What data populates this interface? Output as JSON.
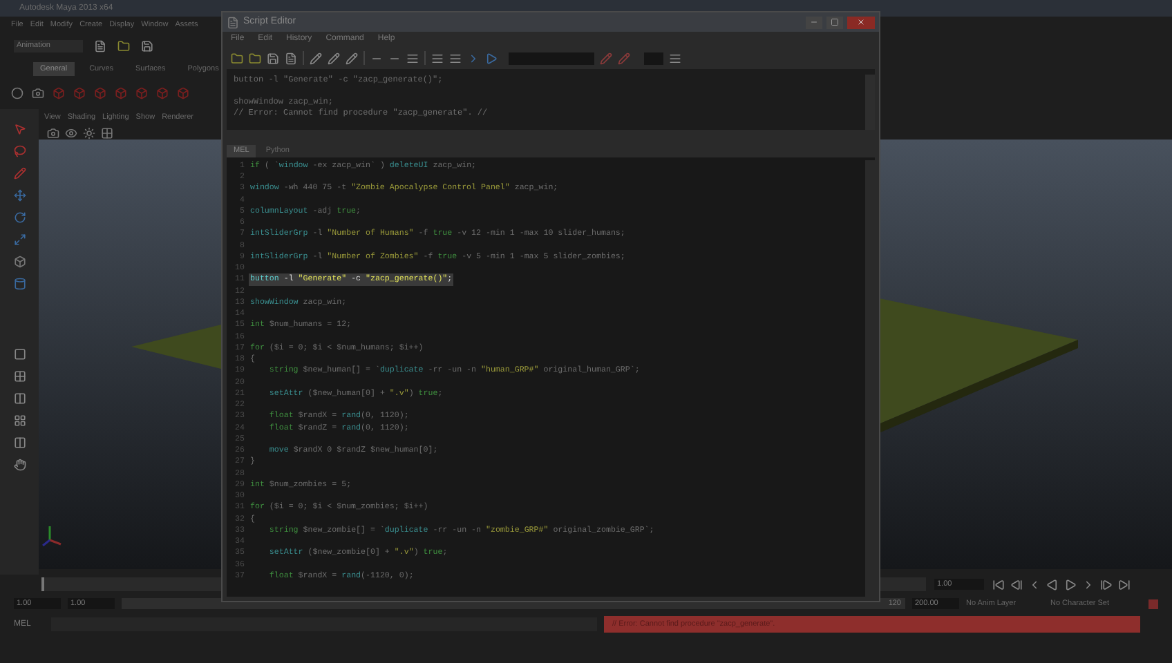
{
  "maya": {
    "title": "Autodesk Maya 2013 x64",
    "menus": [
      "File",
      "Edit",
      "Modify",
      "Create",
      "Display",
      "Window",
      "Assets"
    ],
    "mode": "Animation",
    "shelf_tabs": [
      {
        "label": "General",
        "selected": true
      },
      {
        "label": "Curves",
        "selected": false
      },
      {
        "label": "Surfaces",
        "selected": false
      },
      {
        "label": "Polygons",
        "selected": false
      }
    ],
    "panel_menus": [
      "View",
      "Shading",
      "Lighting",
      "Show",
      "Renderer"
    ],
    "time_slider": {
      "level": 0
    },
    "range_slider": {
      "level": 1
    },
    "current_frame": "1.00",
    "range_start": "1.00",
    "playback_start": "1.00",
    "range_end": "120",
    "playback_end": "200.00",
    "anim_layer": "No Anim Layer",
    "character_set": "No Character Set",
    "command_label": "MEL",
    "error": "// Error: Cannot find procedure \"zacp_generate\"."
  },
  "script_editor": {
    "title": "Script Editor",
    "menus": [
      "File",
      "Edit",
      "History",
      "Command",
      "Help"
    ],
    "history": [
      {
        "kind": "output",
        "text": "button -l \"Generate\" -c \"zacp_generate()\";"
      },
      {
        "kind": "blank"
      },
      {
        "kind": "output",
        "text": "showWindow zacp_win;"
      },
      {
        "kind": "error",
        "text": "// Error: Cannot find procedure \"zacp_generate\". //"
      }
    ],
    "tabs": [
      {
        "label": "MEL",
        "selected": true
      },
      {
        "label": "Python",
        "selected": false
      }
    ],
    "code": [
      {
        "n": "1",
        "highlighted": false,
        "tokens": [
          {
            "kind": "keyword",
            "text": "if"
          },
          {
            "kind": "plain",
            "text": " ( `"
          },
          {
            "kind": "command",
            "text": "window"
          },
          {
            "kind": "plain",
            "text": " -ex zacp_win` ) "
          },
          {
            "kind": "command",
            "text": "deleteUI"
          },
          {
            "kind": "plain",
            "text": " zacp_win;"
          }
        ]
      },
      {
        "n": "2",
        "highlighted": false
      },
      {
        "n": "3",
        "highlighted": false,
        "tokens": [
          {
            "kind": "command",
            "text": "window"
          },
          {
            "kind": "plain",
            "text": " -wh 440 75 -t "
          },
          {
            "kind": "string",
            "text": "\"Zombie Apocalypse Control Panel\""
          },
          {
            "kind": "plain",
            "text": " zacp_win;"
          }
        ]
      },
      {
        "n": "4",
        "highlighted": false
      },
      {
        "n": "5",
        "highlighted": false,
        "tokens": [
          {
            "kind": "command",
            "text": "columnLayout"
          },
          {
            "kind": "plain",
            "text": " -adj "
          },
          {
            "kind": "keyword",
            "text": "true"
          },
          {
            "kind": "plain",
            "text": ";"
          }
        ]
      },
      {
        "n": "6",
        "highlighted": false
      },
      {
        "n": "7",
        "highlighted": false,
        "tokens": [
          {
            "kind": "command",
            "text": "intSliderGrp"
          },
          {
            "kind": "plain",
            "text": " -l "
          },
          {
            "kind": "string",
            "text": "\"Number of Humans\""
          },
          {
            "kind": "plain",
            "text": " -f "
          },
          {
            "kind": "keyword",
            "text": "true"
          },
          {
            "kind": "plain",
            "text": " -v 12 -min 1 -max 10 slider_humans;"
          }
        ]
      },
      {
        "n": "8",
        "highlighted": false
      },
      {
        "n": "9",
        "highlighted": false,
        "tokens": [
          {
            "kind": "command",
            "text": "intSliderGrp"
          },
          {
            "kind": "plain",
            "text": " -l "
          },
          {
            "kind": "string",
            "text": "\"Number of Zombies\""
          },
          {
            "kind": "plain",
            "text": " -f "
          },
          {
            "kind": "keyword",
            "text": "true"
          },
          {
            "kind": "plain",
            "text": " -v 5 -min 1 -max 5 slider_zombies;"
          }
        ]
      },
      {
        "n": "10",
        "highlighted": false
      },
      {
        "n": "11",
        "highlighted": true,
        "tokens": [
          {
            "kind": "command",
            "text": "button"
          },
          {
            "kind": "plain",
            "text": " -l "
          },
          {
            "kind": "string",
            "text": "\"Generate\""
          },
          {
            "kind": "plain",
            "text": " -c "
          },
          {
            "kind": "string",
            "text": "\"zacp_generate()\""
          },
          {
            "kind": "plain",
            "text": ";"
          }
        ]
      },
      {
        "n": "12",
        "highlighted": false
      },
      {
        "n": "13",
        "highlighted": false,
        "tokens": [
          {
            "kind": "command",
            "text": "showWindow"
          },
          {
            "kind": "plain",
            "text": " zacp_win;"
          }
        ]
      },
      {
        "n": "14",
        "highlighted": false
      },
      {
        "n": "15",
        "highlighted": false,
        "tokens": [
          {
            "kind": "keyword",
            "text": "int"
          },
          {
            "kind": "plain",
            "text": " $num_humans = 12;"
          }
        ]
      },
      {
        "n": "16",
        "highlighted": false
      },
      {
        "n": "17",
        "highlighted": false,
        "tokens": [
          {
            "kind": "keyword",
            "text": "for"
          },
          {
            "kind": "plain",
            "text": " ($i = 0; $i < $num_humans; $i++)"
          }
        ]
      },
      {
        "n": "18",
        "highlighted": false,
        "tokens": [
          {
            "kind": "plain",
            "text": "{"
          }
        ]
      },
      {
        "n": "19",
        "highlighted": false,
        "tokens": [
          {
            "kind": "keyword",
            "text": "    string"
          },
          {
            "kind": "plain",
            "text": " $new_human[] = `"
          },
          {
            "kind": "command",
            "text": "duplicate"
          },
          {
            "kind": "plain",
            "text": " -rr -un -n "
          },
          {
            "kind": "string",
            "text": "\"human_GRP#\""
          },
          {
            "kind": "plain",
            "text": " original_human_GRP`;"
          }
        ]
      },
      {
        "n": "20",
        "highlighted": false
      },
      {
        "n": "21",
        "highlighted": false,
        "tokens": [
          {
            "kind": "command",
            "text": "    setAttr"
          },
          {
            "kind": "plain",
            "text": " ($new_human[0] + "
          },
          {
            "kind": "string",
            "text": "\".v\""
          },
          {
            "kind": "plain",
            "text": ") "
          },
          {
            "kind": "keyword",
            "text": "true"
          },
          {
            "kind": "plain",
            "text": ";"
          }
        ]
      },
      {
        "n": "22",
        "highlighted": false
      },
      {
        "n": "23",
        "highlighted": false,
        "tokens": [
          {
            "kind": "keyword",
            "text": "    float"
          },
          {
            "kind": "plain",
            "text": " $randX = "
          },
          {
            "kind": "command",
            "text": "rand"
          },
          {
            "kind": "plain",
            "text": "(0, 1120);"
          }
        ]
      },
      {
        "n": "24",
        "highlighted": false,
        "tokens": [
          {
            "kind": "keyword",
            "text": "    float"
          },
          {
            "kind": "plain",
            "text": " $randZ = "
          },
          {
            "kind": "command",
            "text": "rand"
          },
          {
            "kind": "plain",
            "text": "(0, 1120);"
          }
        ]
      },
      {
        "n": "25",
        "highlighted": false
      },
      {
        "n": "26",
        "highlighted": false,
        "tokens": [
          {
            "kind": "command",
            "text": "    move"
          },
          {
            "kind": "plain",
            "text": " $randX 0 $randZ $new_human[0];"
          }
        ]
      },
      {
        "n": "27",
        "highlighted": false,
        "tokens": [
          {
            "kind": "plain",
            "text": "}"
          }
        ]
      },
      {
        "n": "28",
        "highlighted": false
      },
      {
        "n": "29",
        "highlighted": false,
        "tokens": [
          {
            "kind": "keyword",
            "text": "int"
          },
          {
            "kind": "plain",
            "text": " $num_zombies = 5;"
          }
        ]
      },
      {
        "n": "30",
        "highlighted": false
      },
      {
        "n": "31",
        "highlighted": false,
        "tokens": [
          {
            "kind": "keyword",
            "text": "for"
          },
          {
            "kind": "plain",
            "text": " ($i = 0; $i < $num_zombies; $i++)"
          }
        ]
      },
      {
        "n": "32",
        "highlighted": false,
        "tokens": [
          {
            "kind": "plain",
            "text": "{"
          }
        ]
      },
      {
        "n": "33",
        "highlighted": false,
        "tokens": [
          {
            "kind": "keyword",
            "text": "    string"
          },
          {
            "kind": "plain",
            "text": " $new_zombie[] = `"
          },
          {
            "kind": "command",
            "text": "duplicate"
          },
          {
            "kind": "plain",
            "text": " -rr -un -n "
          },
          {
            "kind": "string",
            "text": "\"zombie_GRP#\""
          },
          {
            "kind": "plain",
            "text": " original_zombie_GRP`;"
          }
        ]
      },
      {
        "n": "34",
        "highlighted": false
      },
      {
        "n": "35",
        "highlighted": false,
        "tokens": [
          {
            "kind": "command",
            "text": "    setAttr"
          },
          {
            "kind": "plain",
            "text": " ($new_zombie[0] + "
          },
          {
            "kind": "string",
            "text": "\".v\""
          },
          {
            "kind": "plain",
            "text": ") "
          },
          {
            "kind": "keyword",
            "text": "true"
          },
          {
            "kind": "plain",
            "text": ";"
          }
        ]
      },
      {
        "n": "36",
        "highlighted": false
      },
      {
        "n": "37",
        "highlighted": false,
        "tokens": [
          {
            "kind": "keyword",
            "text": "    float"
          },
          {
            "kind": "plain",
            "text": " $randX = "
          },
          {
            "kind": "command",
            "text": "rand"
          },
          {
            "kind": "plain",
            "text": "(-1120, 0);"
          }
        ]
      }
    ]
  }
}
